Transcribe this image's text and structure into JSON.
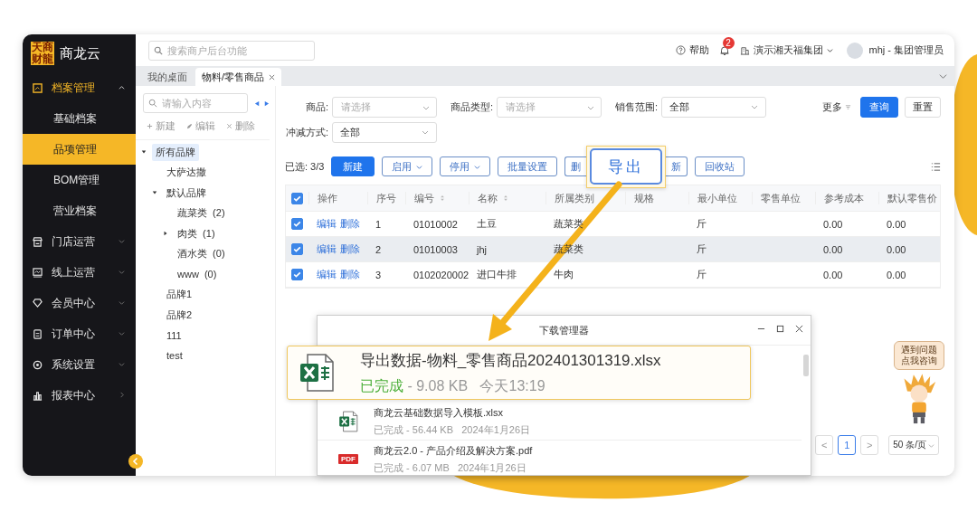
{
  "brand": {
    "mark": "天商财龍",
    "name": "商龙云"
  },
  "sidebar": {
    "items": [
      {
        "label": "档案管理",
        "kind": "group",
        "selected": true,
        "expanded": true,
        "children": [
          {
            "label": "基础档案",
            "selected": false
          },
          {
            "label": "品项管理",
            "selected": true
          },
          {
            "label": "BOM管理",
            "selected": false
          },
          {
            "label": "营业档案",
            "selected": false
          }
        ]
      },
      {
        "label": "门店运营",
        "kind": "group",
        "selected": false,
        "expanded": false
      },
      {
        "label": "线上运营",
        "kind": "group",
        "selected": false,
        "expanded": false
      },
      {
        "label": "会员中心",
        "kind": "group",
        "selected": false,
        "expanded": false
      },
      {
        "label": "订单中心",
        "kind": "group",
        "selected": false,
        "expanded": false
      },
      {
        "label": "系统设置",
        "kind": "group",
        "selected": false,
        "expanded": false
      },
      {
        "label": "报表中心",
        "kind": "link",
        "selected": false
      }
    ]
  },
  "header": {
    "search": {
      "placeholder": "搜索商户后台功能"
    },
    "help": "帮助",
    "notifications": "2",
    "org": "演示湘天福集团",
    "user": "mhj - 集团管理员"
  },
  "tabs": [
    {
      "label": "我的桌面",
      "selected": false,
      "closable": false
    },
    {
      "label": "物料/零售商品",
      "selected": true,
      "closable": true
    }
  ],
  "tree": {
    "search": {
      "placeholder": "请输入内容"
    },
    "actions": [
      "新建",
      "编辑",
      "删除"
    ],
    "nodes": [
      {
        "label": "所有品牌",
        "selected": true,
        "expanded": true,
        "children": [
          {
            "label": "大萨达撒",
            "selected": false
          },
          {
            "label": "默认品牌",
            "selected": false,
            "expanded": true,
            "children": [
              {
                "label": "蔬菜类",
                "count": "(2)",
                "selected": false
              },
              {
                "label": "肉类",
                "count": "(1)",
                "selected": false,
                "expanded": false
              },
              {
                "label": "酒水类",
                "count": "(0)",
                "selected": false
              },
              {
                "label": "www",
                "count": "(0)",
                "selected": false
              }
            ]
          },
          {
            "label": "品牌1",
            "selected": false
          },
          {
            "label": "品牌2",
            "selected": false
          },
          {
            "label": "111",
            "selected": false
          },
          {
            "label": "test",
            "selected": false
          }
        ]
      }
    ]
  },
  "filters": [
    {
      "label": "商品:",
      "placeholder": "请选择"
    },
    {
      "label": "商品类型:",
      "placeholder": "请选择"
    },
    {
      "label": "销售范围:",
      "value": "全部"
    },
    {
      "label": "冲减方式:",
      "value": "全部"
    }
  ],
  "filter_actions": {
    "more": "更多",
    "query": "查询",
    "reset": "重置"
  },
  "toolbar": {
    "selected_count": "已选: 3/3",
    "buttons": [
      {
        "label": "新建",
        "kind": "primary"
      },
      {
        "label": "启用",
        "kind": "dropdown"
      },
      {
        "label": "停用",
        "kind": "dropdown"
      },
      {
        "label": "批量设置",
        "kind": "plain"
      },
      {
        "label": "删",
        "kind": "cut-left"
      },
      {
        "label": "导出",
        "kind": "spotlight"
      },
      {
        "label": "新",
        "kind": "cut-right"
      },
      {
        "label": "回收站",
        "kind": "plain"
      }
    ]
  },
  "table": {
    "header_checked": true,
    "columns": [
      {
        "label": "操作"
      },
      {
        "label": "序号"
      },
      {
        "label": "编号",
        "sortable": true
      },
      {
        "label": "名称",
        "sortable": true
      },
      {
        "label": "所属类别"
      },
      {
        "label": "规格"
      },
      {
        "label": "最小单位"
      },
      {
        "label": "零售单位"
      },
      {
        "label": "参考成本"
      },
      {
        "label": "默认零售价"
      }
    ],
    "rows": [
      {
        "checked": true,
        "highlighted": false,
        "cells": [
          [
            "编辑",
            "删除"
          ],
          "1",
          "01010002",
          "土豆",
          "蔬菜类",
          null,
          "斤",
          null,
          "0.00",
          "0.00"
        ]
      },
      {
        "checked": true,
        "highlighted": true,
        "cells": [
          [
            "编辑",
            "删除"
          ],
          "2",
          "01010003",
          "jhj",
          "蔬菜类",
          null,
          "斤",
          null,
          "0.00",
          "0.00"
        ]
      },
      {
        "checked": true,
        "highlighted": false,
        "cells": [
          [
            "编辑",
            "删除"
          ],
          "3",
          "0102020002",
          "进口牛排",
          "牛肉",
          null,
          "斤",
          null,
          "0.00",
          "0.00"
        ]
      }
    ]
  },
  "pagination": {
    "prev": "<",
    "pages": [
      {
        "label": "1",
        "selected": true
      }
    ],
    "next": ">",
    "page_size": "50 条/页"
  },
  "assistant": {
    "bubble": [
      "遇到问题",
      "点我咨询"
    ]
  },
  "download_manager": {
    "title": "下载管理器",
    "items": [
      {
        "kind": "excel",
        "highlighted": true,
        "name": "导出数据-物料_零售商品202401301319.xlsx",
        "status": "已完成",
        "detail": "- 9.08 KB",
        "time": "今天13:19"
      },
      {
        "kind": "excel",
        "highlighted": false,
        "name": "商龙云基础数据导入模板.xlsx",
        "status": "已完成",
        "detail": "- 56.44 KB",
        "time": "2024年1月26日"
      },
      {
        "kind": "pdf",
        "highlighted": false,
        "badge": "PDF",
        "name": "商龙云2.0 - 产品介绍及解决方案.pdf",
        "status": "已完成",
        "detail": "- 6.07 MB",
        "time": "2024年1月26日"
      }
    ]
  }
}
